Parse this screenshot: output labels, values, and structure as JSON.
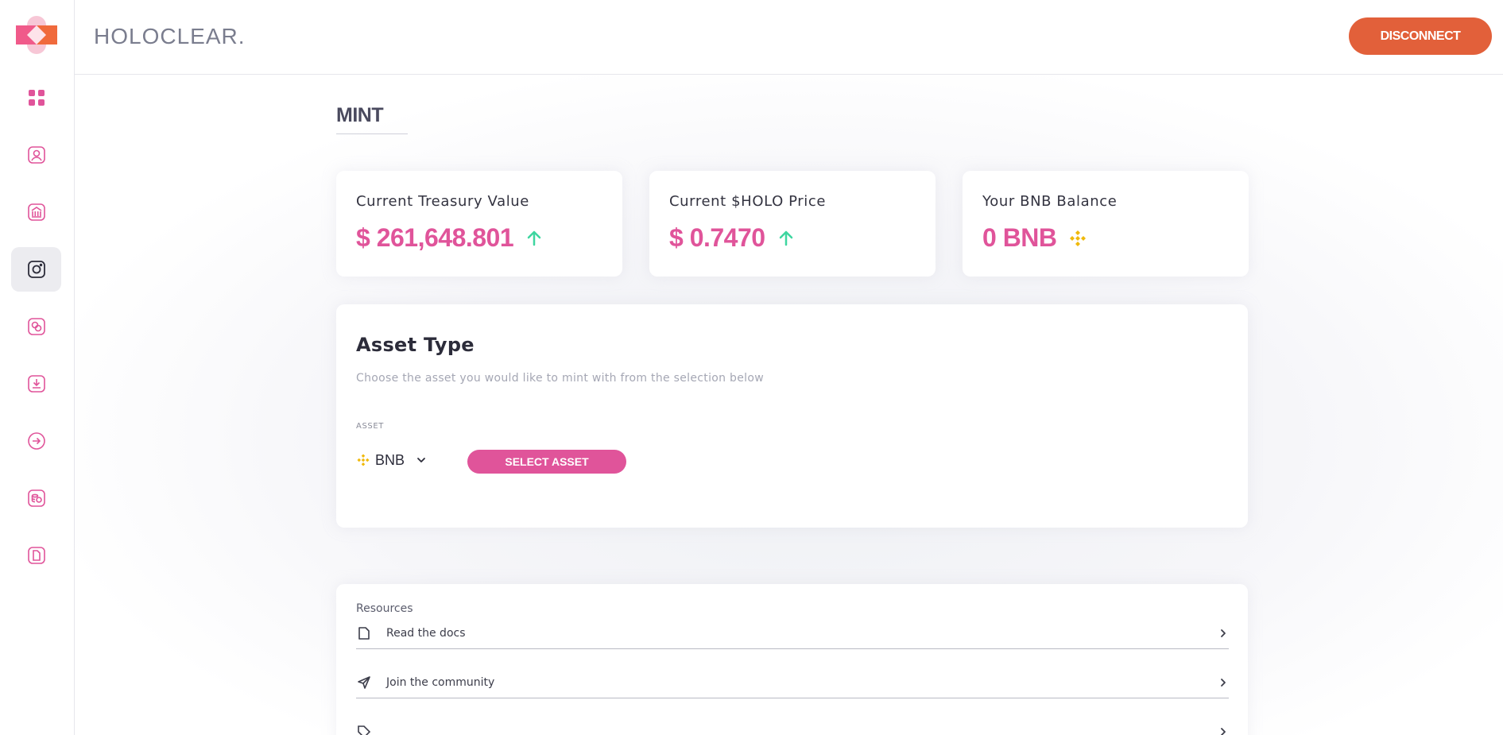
{
  "app": {
    "brand": "HOLOCLEAR."
  },
  "header": {
    "disconnect_label": "DISCONNECT"
  },
  "colors": {
    "accent_pink": "#e0549a",
    "accent_orange": "#e2603a",
    "up_arrow": "#3ed6a0",
    "bnb_gold": "#f0b90b"
  },
  "sidebar": {
    "items": [
      {
        "icon": "dashboard-icon",
        "active": false
      },
      {
        "icon": "user-icon",
        "active": false
      },
      {
        "icon": "bank-icon",
        "active": false
      },
      {
        "icon": "mint-icon",
        "active": true
      },
      {
        "icon": "exchange-icon",
        "active": false
      },
      {
        "icon": "download-icon",
        "active": false
      },
      {
        "icon": "login-icon",
        "active": false
      },
      {
        "icon": "coins-icon",
        "active": false
      },
      {
        "icon": "docs-icon",
        "active": false
      }
    ]
  },
  "page": {
    "title": "MINT"
  },
  "stats": [
    {
      "label": "Current Treasury Value",
      "value": "$ 261,648.801",
      "icon": "arrow-up-icon"
    },
    {
      "label": "Current $HOLO Price",
      "value": "$ 0.7470",
      "icon": "arrow-up-icon"
    },
    {
      "label": "Your BNB Balance",
      "value": "0 BNB",
      "icon": "bnb-icon"
    }
  ],
  "asset": {
    "title": "Asset Type",
    "subtitle": "Choose the asset you would like to mint with from the selection below",
    "field_label": "ASSET",
    "selected": "BNB",
    "button_label": "SELECT ASSET"
  },
  "resources": {
    "title": "Resources",
    "items": [
      {
        "label": "Read the docs",
        "icon": "docs-icon"
      },
      {
        "label": "Join the community",
        "icon": "send-icon"
      },
      {
        "label": "",
        "icon": "tag-icon"
      }
    ]
  }
}
